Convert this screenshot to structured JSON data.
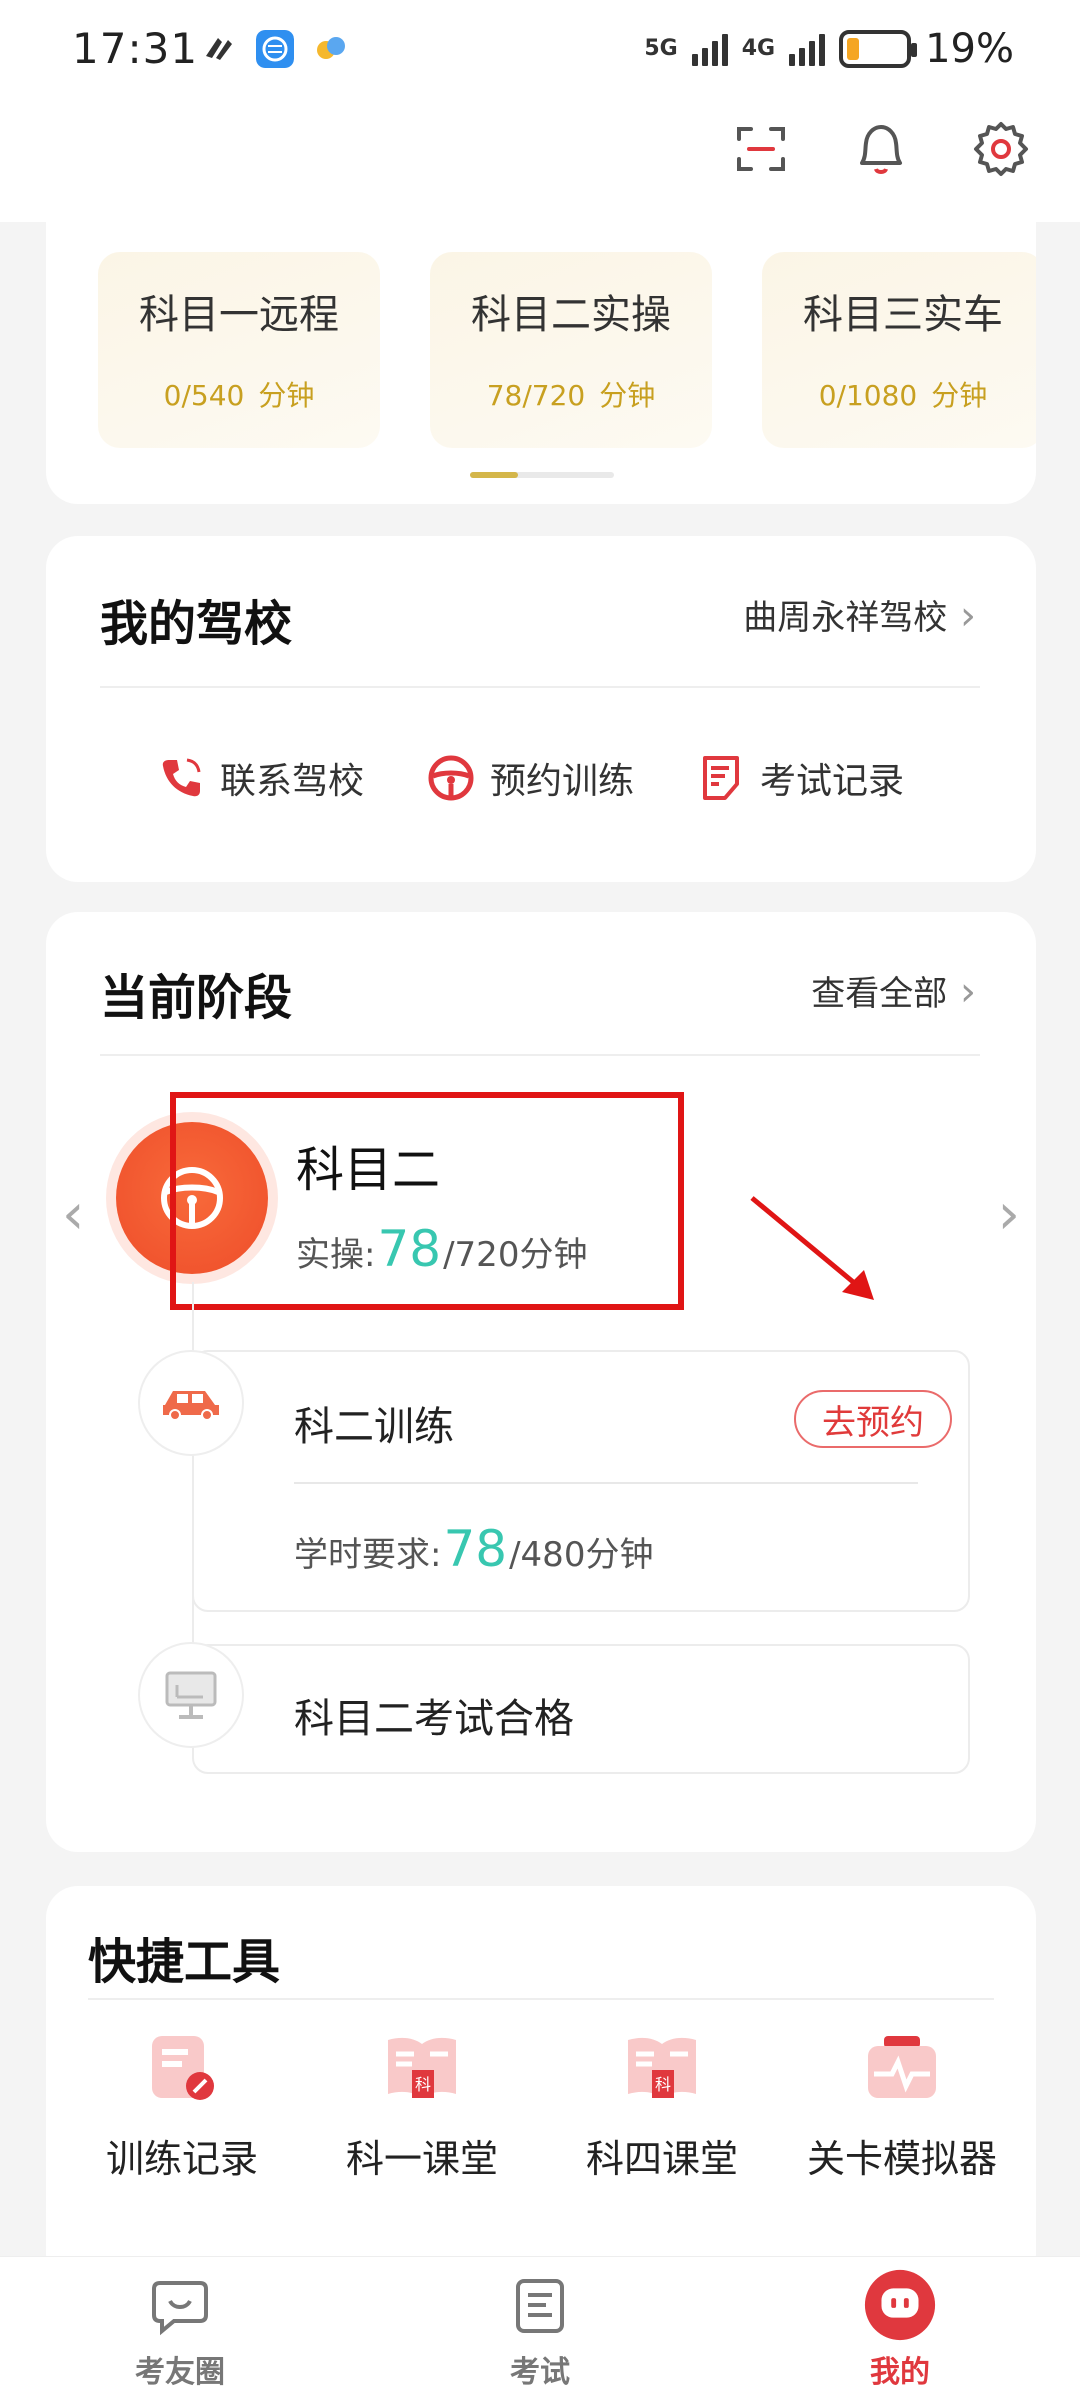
{
  "status_bar": {
    "time": "17:31",
    "signal_1": "5G",
    "signal_2": "4G",
    "battery": "19%"
  },
  "top_icons": [
    "scan-icon",
    "bell-icon",
    "gear-icon"
  ],
  "courses": [
    {
      "title": "科目一远程",
      "progress": "0/540",
      "unit": "分钟"
    },
    {
      "title": "科目二实操",
      "progress": "78/720",
      "unit": "分钟"
    },
    {
      "title": "科目三实车",
      "progress": "0/1080",
      "unit": "分钟"
    }
  ],
  "school": {
    "title": "我的驾校",
    "name": "曲周永祥驾校",
    "actions": [
      {
        "label": "联系驾校",
        "icon": "phone-icon"
      },
      {
        "label": "预约训练",
        "icon": "steering-wheel-icon"
      },
      {
        "label": "考试记录",
        "icon": "document-icon"
      }
    ]
  },
  "stage": {
    "title": "当前阶段",
    "view_all": "查看全部",
    "name": "科目二",
    "progress_label": "实操:",
    "progress_value": "78",
    "progress_total": "/720分钟",
    "steps": [
      {
        "title": "科二训练",
        "button": "去预约",
        "req_label": "学时要求:",
        "req_value": "78",
        "req_total": "/480分钟"
      },
      {
        "title": "科目二考试合格"
      }
    ]
  },
  "tools": {
    "title": "快捷工具",
    "items": [
      {
        "label": "训练记录",
        "icon": "training-record-icon"
      },
      {
        "label": "科一课堂",
        "icon": "book-icon"
      },
      {
        "label": "科四课堂",
        "icon": "book-icon"
      },
      {
        "label": "关卡模拟器",
        "icon": "simulator-icon"
      }
    ]
  },
  "bottom_nav": [
    {
      "label": "考友圈",
      "icon": "chat-icon"
    },
    {
      "label": "考试",
      "icon": "exam-icon"
    },
    {
      "label": "我的",
      "icon": "profile-icon"
    }
  ],
  "colors": {
    "accent": "#e0383e",
    "teal": "#38c7b0",
    "gold": "#c8a020",
    "highlight_box": "#e01515"
  }
}
